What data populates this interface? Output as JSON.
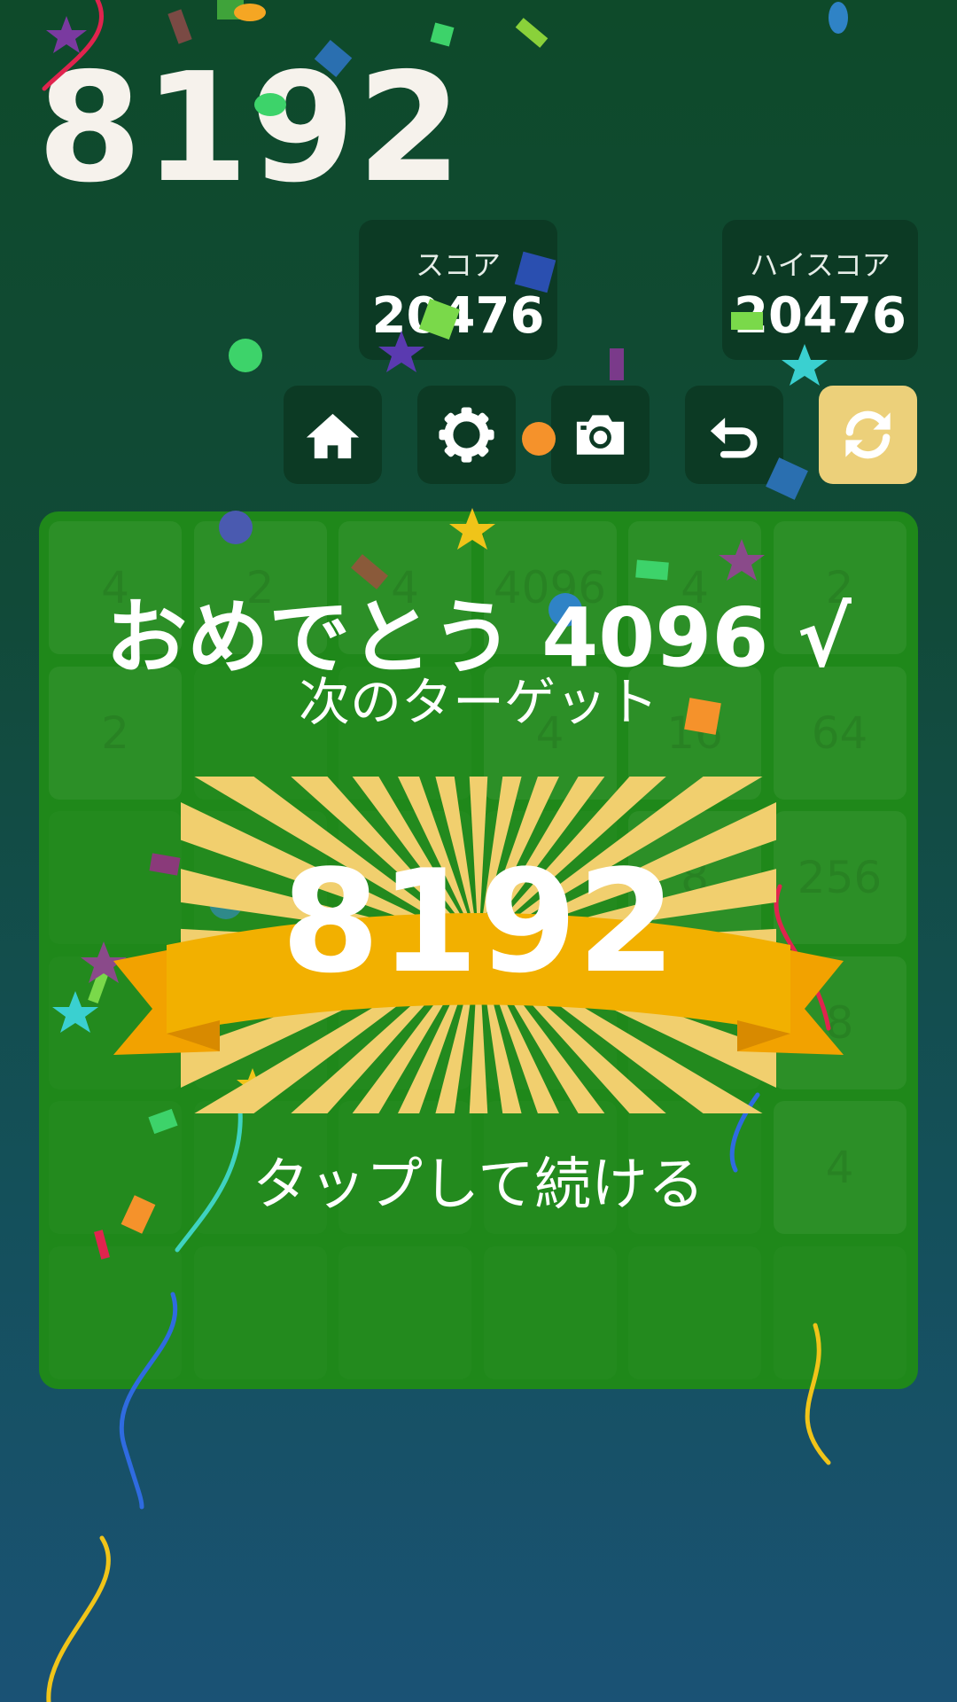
{
  "header": {
    "title": "8192"
  },
  "score": {
    "label": "スコア",
    "value": "20476"
  },
  "best": {
    "label": "ハイスコア",
    "value": "20476"
  },
  "toolbar": {
    "icons": [
      "home-icon",
      "gear-icon",
      "camera-icon",
      "undo-icon",
      "restart-icon"
    ]
  },
  "board": {
    "tiles": [
      [
        "4",
        "2",
        "4",
        "4096",
        "4",
        "2"
      ],
      [
        "2",
        "",
        "",
        "4",
        "16",
        "64"
      ],
      [
        "",
        "",
        "",
        "",
        "8",
        "256"
      ],
      [
        "",
        "",
        "",
        "",
        "",
        "8"
      ],
      [
        "",
        "",
        "",
        "",
        "",
        "4"
      ],
      [
        "",
        "",
        "",
        "",
        "",
        ""
      ]
    ]
  },
  "overlay": {
    "congrats": "おめでとう 4096 √",
    "next_target_label": "次のターゲット",
    "next_target_value": "8192",
    "tap_to_continue": "タップして続ける"
  },
  "colors": {
    "background_top": "#0e4a2a",
    "background_bottom": "#1a5275",
    "board": "#1f881a",
    "panel": "#0c3a24",
    "restart_button": "#ecd07a",
    "ribbon": "#f2b000",
    "rays": "#f1cf6e"
  }
}
